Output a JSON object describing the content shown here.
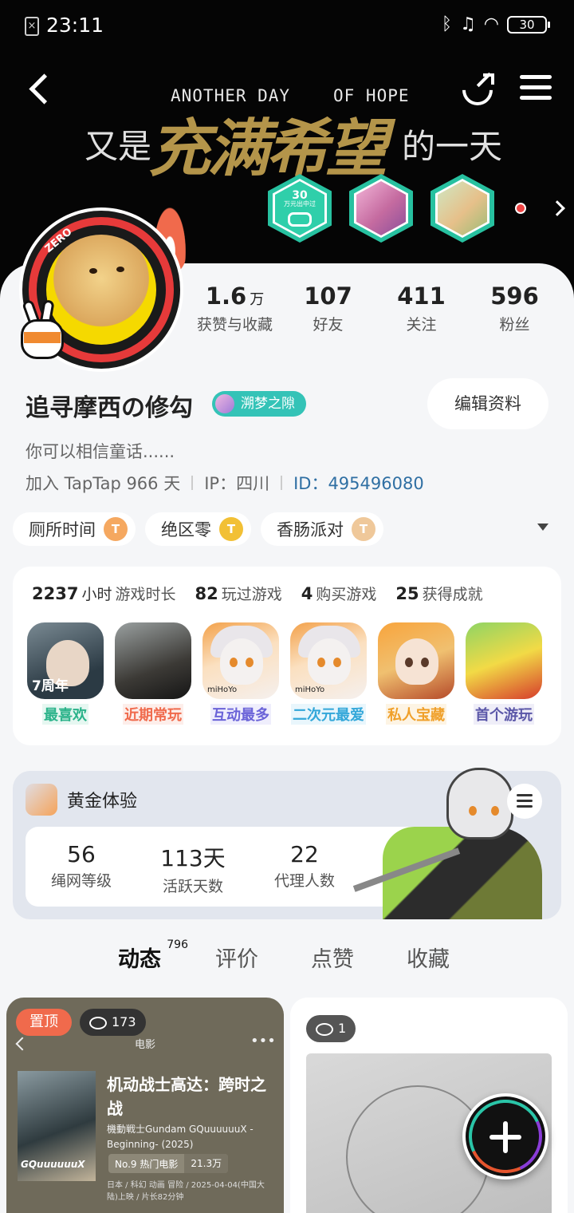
{
  "status_bar": {
    "time": "23:11",
    "battery": "30"
  },
  "banner": {
    "line1": "ANOTHER DAY",
    "line2": "OF HOPE",
    "cn_left": "又是",
    "cn_big": "充满希望",
    "cn_right": "的一天"
  },
  "badges": [
    {
      "name": "game-badge",
      "value": "30",
      "text": "万元出中过"
    },
    {
      "name": "girl-badge"
    },
    {
      "name": "cat-badge"
    }
  ],
  "stats": [
    {
      "value": "1.6",
      "unit": "万",
      "label": "获赞与收藏"
    },
    {
      "value": "107",
      "label": "好友"
    },
    {
      "value": "411",
      "label": "关注"
    },
    {
      "value": "596",
      "label": "粉丝"
    }
  ],
  "profile": {
    "name": "追寻摩西の修勾",
    "tag": "溯梦之隙",
    "edit_label": "编辑资料",
    "bio": "你可以相信童话......",
    "joined": "加入 TapTap 966 天",
    "ip": "IP：四川",
    "id": "ID：495496080"
  },
  "chips": [
    {
      "label": "厕所时间",
      "coin": "T"
    },
    {
      "label": "绝区零",
      "coin": "T"
    },
    {
      "label": "香肠派对",
      "coin": "T"
    }
  ],
  "game_stats": {
    "hours": "2237",
    "hours_unit": "小时",
    "hours_label": "游戏时长",
    "played": "82",
    "played_label": "玩过游戏",
    "bought": "4",
    "bought_label": "购买游戏",
    "achievements": "25",
    "achievements_label": "获得成就"
  },
  "games": [
    {
      "label": "最喜欢",
      "note": "7周年"
    },
    {
      "label": "近期常玩"
    },
    {
      "label": "互动最多",
      "note": "miHoYo"
    },
    {
      "label": "二次元最爱",
      "note": "miHoYo"
    },
    {
      "label": "私人宝藏"
    },
    {
      "label": "首个游玩"
    }
  ],
  "gold": {
    "title": "黄金体验",
    "items": [
      {
        "value": "56",
        "label": "绳网等级"
      },
      {
        "value": "113天",
        "label": "活跃天数"
      },
      {
        "value": "22",
        "label": "代理人数"
      }
    ]
  },
  "tabs": [
    {
      "label": "动态",
      "count": "796"
    },
    {
      "label": "评价"
    },
    {
      "label": "点赞"
    },
    {
      "label": "收藏"
    }
  ],
  "feed": {
    "post1": {
      "pin": "置顶",
      "views": "173",
      "sub": "电影",
      "poster_text": "GQuuuuuuX",
      "title": "机动战士高达：跨时之战",
      "subtitle": "機動戦士Gundam GQuuuuuuX -Beginning- (2025)",
      "rank": "No.9 热门电影",
      "heat": "21.3万",
      "info": "日本 / 科幻 动画 冒险 / 2025-04-04(中国大陆)上映 / 片长82分钟"
    },
    "post2": {
      "views": "1"
    }
  }
}
